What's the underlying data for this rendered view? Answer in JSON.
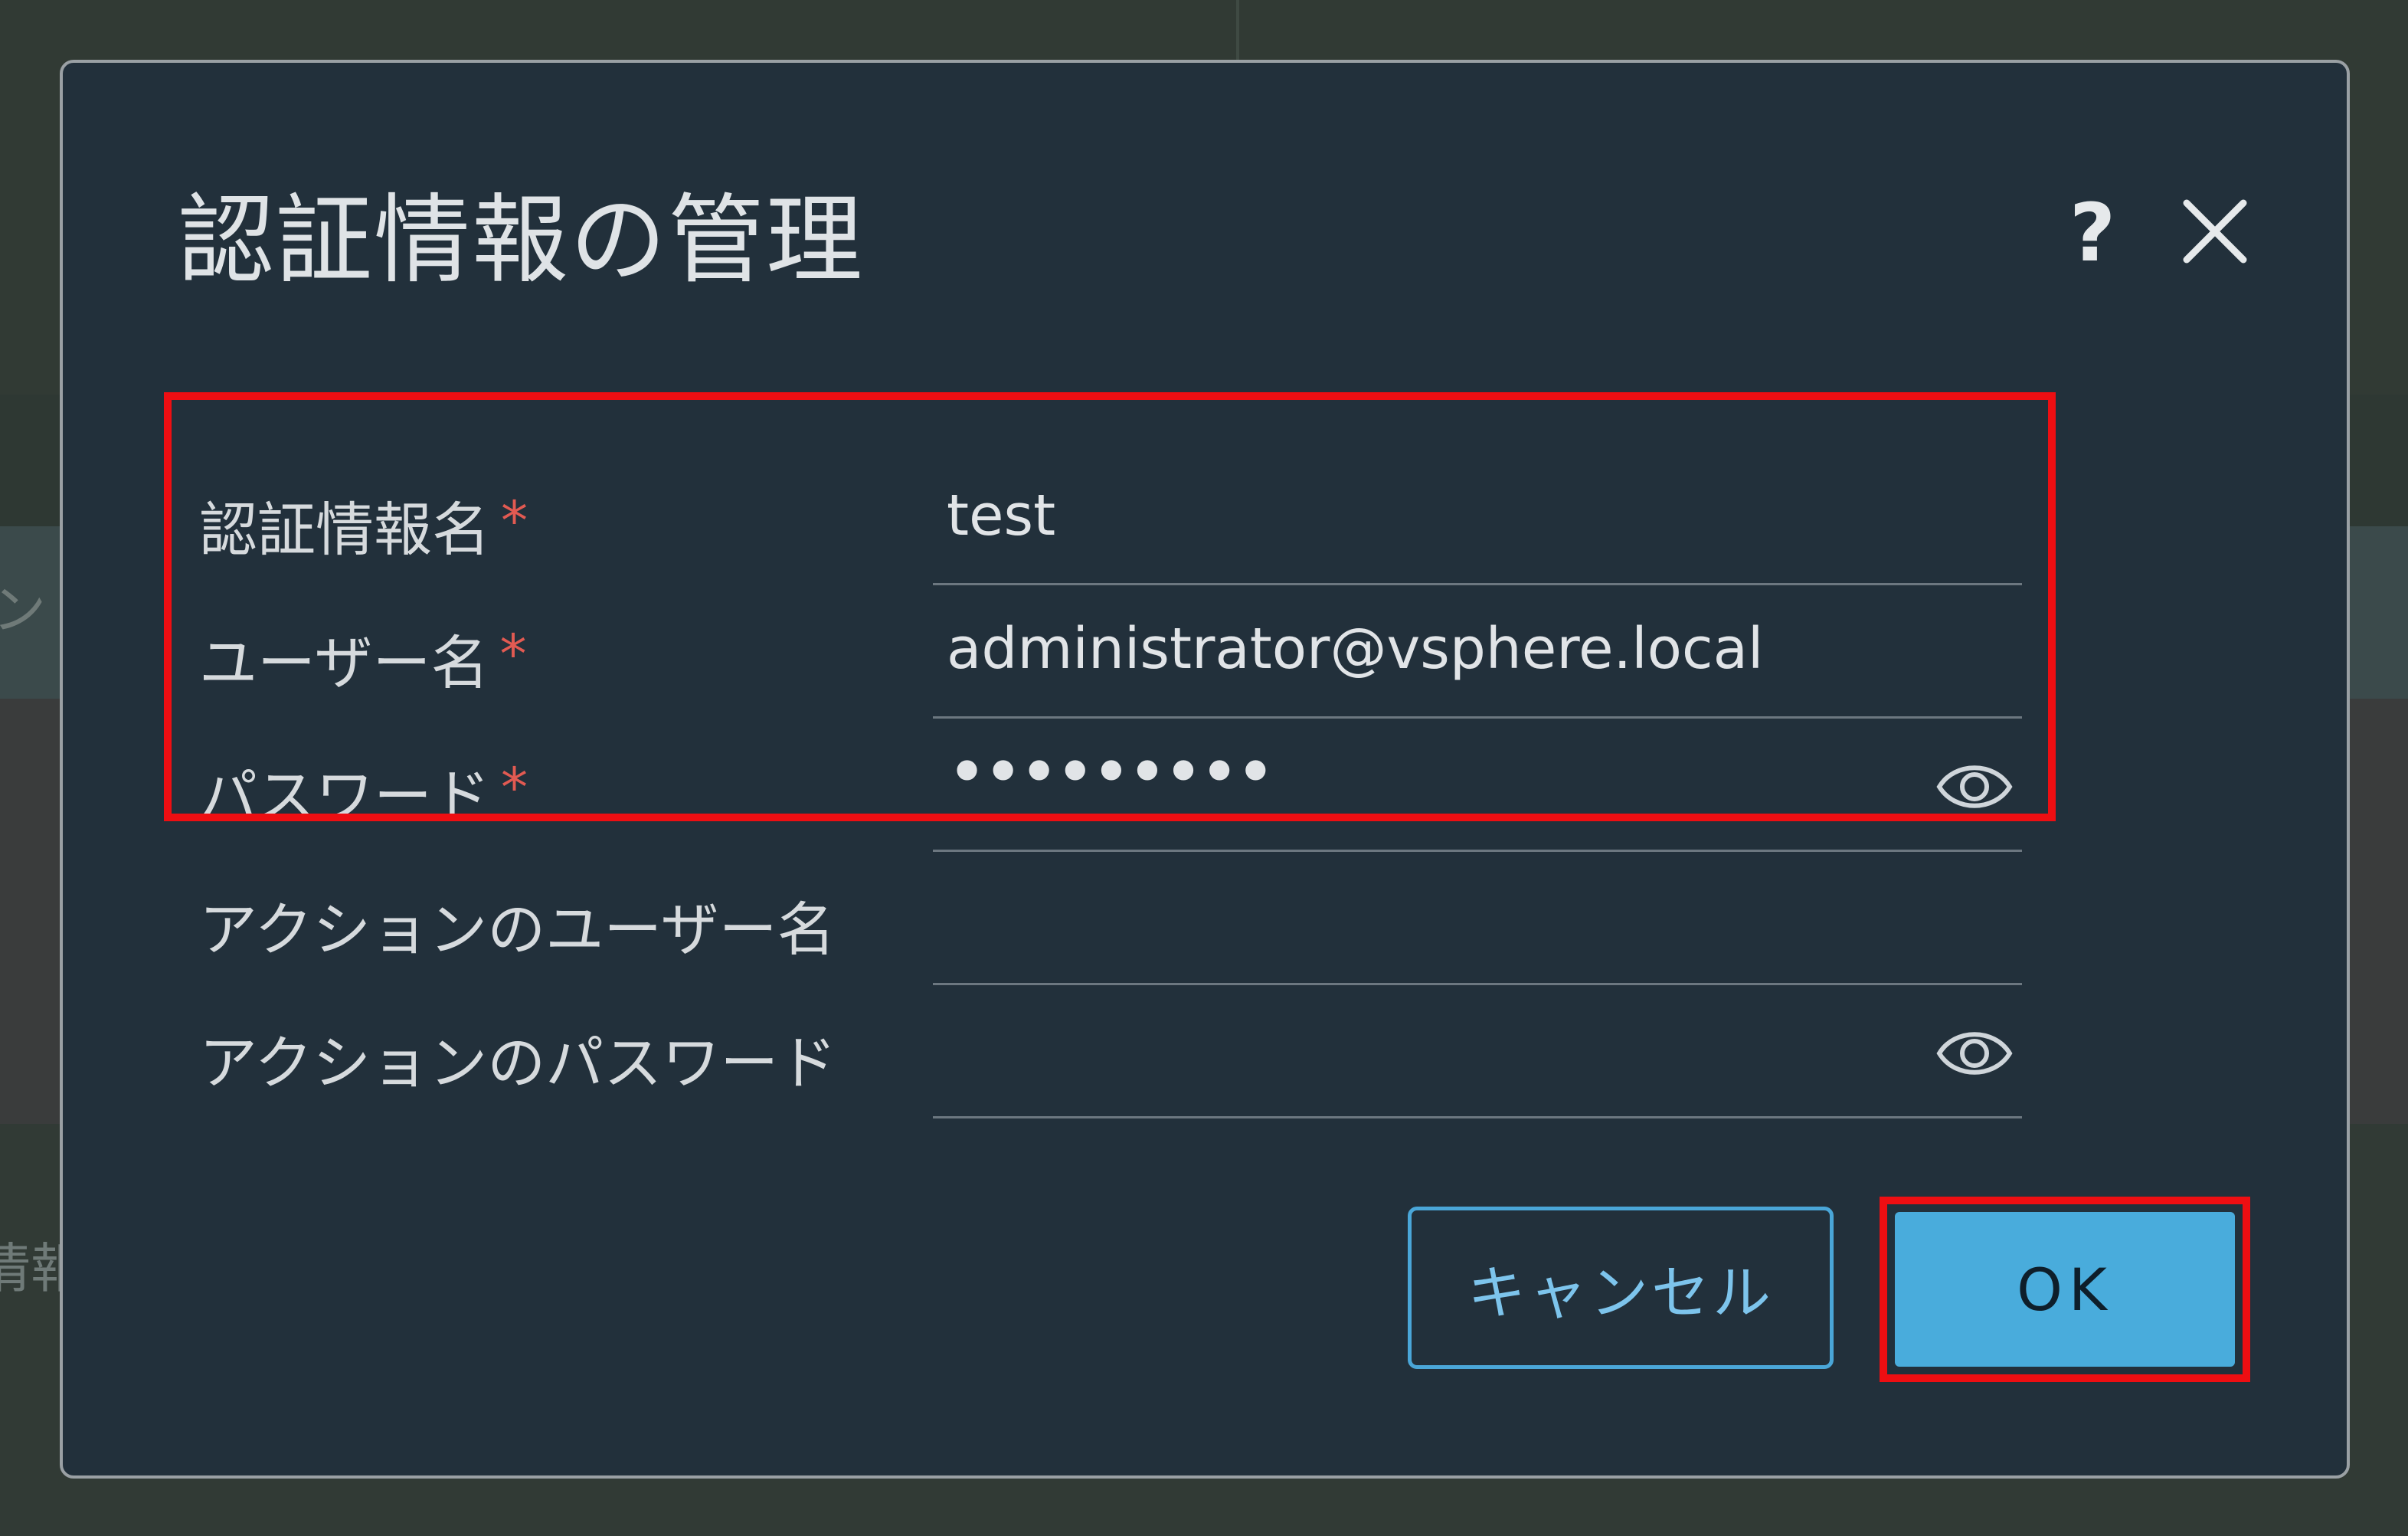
{
  "background": {
    "fragment_left_mid": "ン",
    "fragment_left_bottom": "情報"
  },
  "dialog": {
    "title": "認証情報の管理",
    "help_label": "?",
    "close_icon": "close-icon",
    "fields": [
      {
        "label": "認証情報名",
        "required": true,
        "required_mark": "*",
        "value": "test",
        "type": "text"
      },
      {
        "label": "ユーザー名",
        "required": true,
        "required_mark": "*",
        "value": "administrator@vsphere.local",
        "type": "text"
      },
      {
        "label": "パスワード",
        "required": true,
        "required_mark": "*",
        "value": "•••••••••",
        "type": "password",
        "icon": "eye-icon"
      },
      {
        "label": "アクションのユーザー名",
        "required": false,
        "value": "",
        "type": "text"
      },
      {
        "label": "アクションのパスワード",
        "required": false,
        "value": "",
        "type": "password",
        "icon": "eye-icon"
      }
    ],
    "buttons": {
      "cancel_label": "キャンセル",
      "ok_label": "OK"
    }
  },
  "colors": {
    "dialog_bg": "#22303b",
    "accent": "#49acdc",
    "required": "#e25a52",
    "annotation": "#ee0e12"
  }
}
